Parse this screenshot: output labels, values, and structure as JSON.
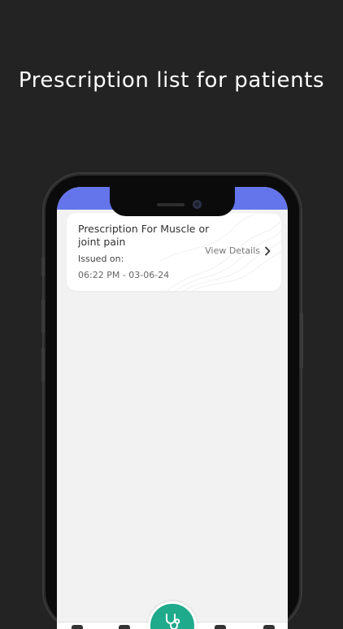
{
  "headline": "Prescription list for patients",
  "prescriptions": [
    {
      "title": "Prescription For Muscle or joint pain",
      "issued_label": "Issued on:",
      "issued_value": "06:22 PM - 03-06-24",
      "action_label": "View Details",
      "action_icon": "chevron-right-icon"
    }
  ],
  "fab_icon": "stethoscope-icon",
  "colors": {
    "background": "#232323",
    "status_band": "#6474ea",
    "fab": "#1faa8c",
    "screen_bg": "#f2f2f2"
  }
}
